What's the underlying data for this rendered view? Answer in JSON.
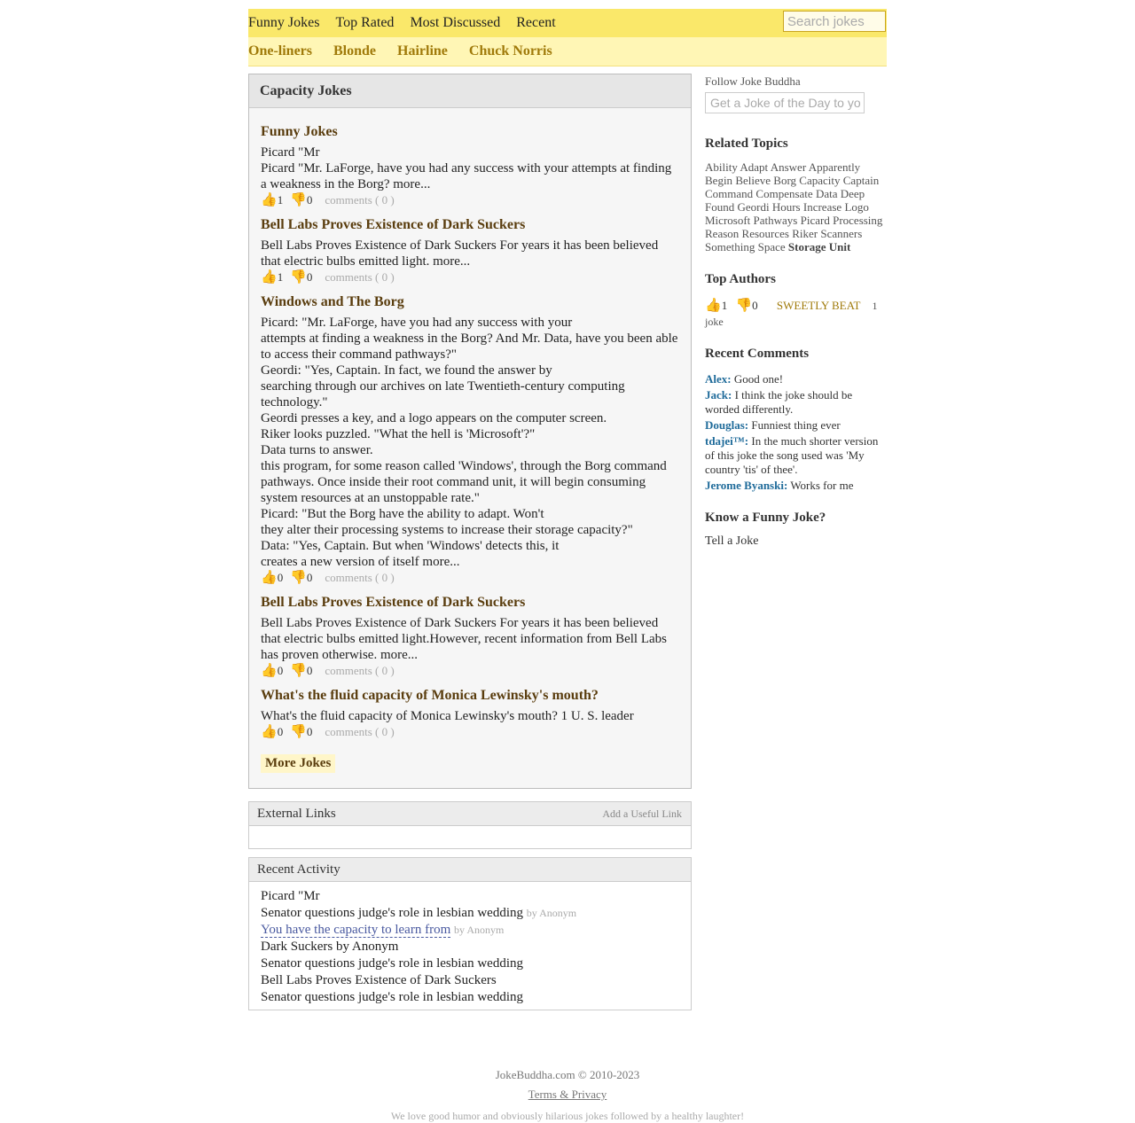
{
  "nav": {
    "primary": [
      "Funny Jokes",
      "Top Rated",
      "Most Discussed",
      "Recent"
    ],
    "search_placeholder": "Search jokes",
    "categories": [
      "One-liners",
      "Blonde",
      "Hairline",
      "Chuck Norris"
    ]
  },
  "main": {
    "title": "Capacity Jokes",
    "jokes": [
      {
        "title": "Funny Jokes",
        "lines": [
          "Picard \"Mr",
          "Picard \"Mr. LaForge, have you had any success with your attempts at finding a weakness in the Borg? more..."
        ],
        "up": "1",
        "down": "0",
        "comments": "comments ( 0 )"
      },
      {
        "title": "Bell Labs Proves Existence of Dark Suckers",
        "lines": [
          "Bell Labs Proves Existence of Dark Suckers For years it has been believed that electric bulbs emitted light. more..."
        ],
        "up": "1",
        "down": "0",
        "comments": "comments ( 0 )"
      },
      {
        "title": "Windows and The Borg",
        "lines": [
          "Picard: \"Mr. LaForge, have you had any success with your",
          "attempts at finding a weakness in the Borg? And Mr. Data, have you been able to access their command pathways?\"",
          "Geordi: \"Yes, Captain. In fact, we found the answer by",
          "searching through our archives on late Twentieth-century computing technology.\"",
          "Geordi presses a key, and a logo appears on the computer screen.",
          "Riker looks puzzled. \"What the hell is 'Microsoft'?\"",
          "Data turns to answer.",
          "this program, for some reason called 'Windows', through the Borg command pathways. Once inside their root command unit, it will begin consuming system resources at an unstoppable rate.\"",
          "Picard: \"But the Borg have the ability to adapt. Won't",
          "they alter their processing systems to increase their storage capacity?\"",
          "Data: \"Yes, Captain. But when 'Windows' detects this, it",
          "creates a new version of itself more..."
        ],
        "up": "0",
        "down": "0",
        "comments": "comments ( 0 )"
      },
      {
        "title": "Bell Labs Proves Existence of Dark Suckers",
        "lines": [
          "Bell Labs Proves Existence of Dark Suckers For years it has been believed that electric bulbs emitted light.However, recent information from Bell Labs has proven otherwise. more..."
        ],
        "up": "0",
        "down": "0",
        "comments": "comments ( 0 )"
      },
      {
        "title": "What's the fluid capacity of Monica Lewinsky's mouth?",
        "lines": [
          "What's the fluid capacity of Monica Lewinsky's mouth? 1 U. S. leader"
        ],
        "up": "0",
        "down": "0",
        "comments": "comments ( 0 )"
      }
    ],
    "more_label": "More Jokes"
  },
  "external": {
    "title": "External Links",
    "action": "Add a Useful Link"
  },
  "activity": {
    "title": "Recent Activity",
    "items": [
      {
        "text": "Picard \"Mr",
        "by": ""
      },
      {
        "text": "Senator questions judge's role in lesbian wedding",
        "by": "by Anonym"
      },
      {
        "text": "You have the capacity to learn from",
        "by": "by Anonym",
        "link": true
      },
      {
        "text": "Dark Suckers by Anonym",
        "by": ""
      },
      {
        "text": "Senator questions judge's role in lesbian wedding",
        "by": ""
      },
      {
        "text": "Bell Labs Proves Existence of Dark Suckers",
        "by": ""
      },
      {
        "text": "Senator questions judge's role in lesbian wedding",
        "by": ""
      }
    ]
  },
  "side": {
    "follow_label": "Follow Joke Buddha",
    "follow_placeholder": "Get a Joke of the Day to yo",
    "related_title": "Related Topics",
    "topics": [
      "Ability",
      "Adapt",
      "Answer",
      "Apparently",
      "Begin",
      "Believe",
      "Borg",
      "Capacity",
      "Captain",
      "Command",
      "Compensate",
      "Data",
      "Deep",
      "Found",
      "Geordi",
      "Hours",
      "Increase",
      "Logo",
      "Microsoft",
      "Pathways",
      "Picard",
      "Processing",
      "Reason",
      "Resources",
      "Riker",
      "Scanners",
      "Something",
      "Space"
    ],
    "topic_bold": "Storage Unit",
    "authors_title": "Top Authors",
    "author": {
      "up": "1",
      "down": "0",
      "name": "SWEETLY BEAT",
      "count": "1",
      "unit": "joke"
    },
    "comments_title": "Recent Comments",
    "comments": [
      {
        "who": "Alex:",
        "text": "Good one!"
      },
      {
        "who": "Jack:",
        "text": "I think the joke should be worded differently."
      },
      {
        "who": "Douglas:",
        "text": "Funniest thing ever"
      },
      {
        "who": "tdajei™:",
        "text": "In the much shorter version of this joke the song used was 'My country 'tis' of thee'."
      },
      {
        "who": "Jerome Byanski:",
        "text": "Works for me"
      }
    ],
    "know_title": "Know a Funny Joke?",
    "tell_label": "Tell a Joke"
  },
  "footer": {
    "copyright": "JokeBuddha.com © 2010-2023",
    "terms": "Terms & Privacy",
    "tagline": "We love good humor and obviously hilarious jokes followed by a healthy laughter!"
  }
}
